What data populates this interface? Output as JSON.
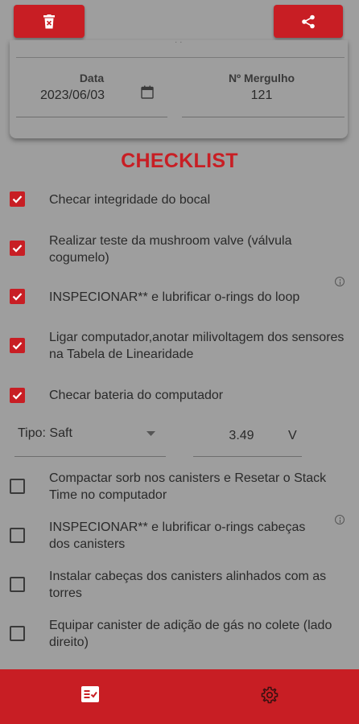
{
  "header": {
    "delete_icon": "trash-icon",
    "share_icon": "share-icon",
    "accent_color": "#c81e24"
  },
  "card": {
    "date_label": "Data",
    "date_value": "2023/06/03",
    "calendar_icon": "calendar-icon",
    "dive_label": "Nº Mergulho",
    "dive_value": "121"
  },
  "checklist": {
    "title": "CHECKLIST",
    "items": [
      {
        "text": "Checar integridade do bocal",
        "checked": true
      },
      {
        "text": "Realizar teste da mushroom valve (válvula cogumelo)",
        "checked": true
      },
      {
        "text": "INSPECIONAR** e lubrificar o-rings do loop",
        "checked": true,
        "info": true
      },
      {
        "text": "Ligar computador,anotar milivoltagem dos sensores na Tabela de Linearidade",
        "checked": true
      },
      {
        "text": "Checar bateria do computador",
        "checked": true
      },
      {
        "text": "Compactar sorb nos canisters e Resetar o Stack Time no computador",
        "checked": false
      },
      {
        "text": "INSPECIONAR** e lubrificar o-rings cabeças dos canisters",
        "checked": false,
        "info": true
      },
      {
        "text": "Instalar cabeças dos canisters alinhados com as torres",
        "checked": false
      },
      {
        "text": "Equipar canister de adição de gás no colete (lado direito)",
        "checked": false
      }
    ]
  },
  "battery": {
    "type_label": "Tipo: Saft",
    "voltage": "3.49",
    "unit": "V"
  },
  "bottom_nav": {
    "checklist_icon": "checklist-icon",
    "settings_icon": "gear-icon"
  }
}
